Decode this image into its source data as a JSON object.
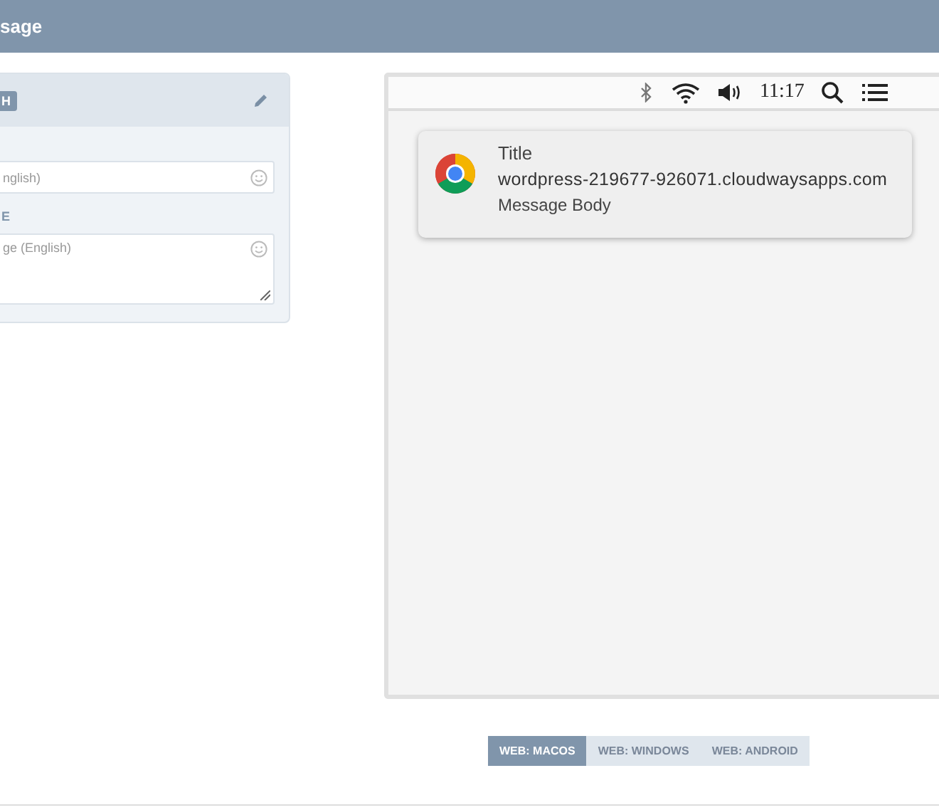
{
  "header": {
    "title": "sage"
  },
  "editor": {
    "badge": "H",
    "fields": [
      {
        "kind": "input",
        "placeholder": "nglish)"
      },
      {
        "kind": "textarea",
        "label": "E",
        "placeholder": "ge (English)"
      }
    ]
  },
  "preview": {
    "menubar": {
      "time": "11:17"
    },
    "notification": {
      "title": "Title",
      "site": "wordpress-219677-926071.cloudwaysapps.com",
      "body": "Message Body"
    }
  },
  "tabs": [
    {
      "label": "WEB: MACOS",
      "selected": true
    },
    {
      "label": "WEB: WINDOWS",
      "selected": false
    },
    {
      "label": "WEB: ANDROID",
      "selected": false
    }
  ]
}
